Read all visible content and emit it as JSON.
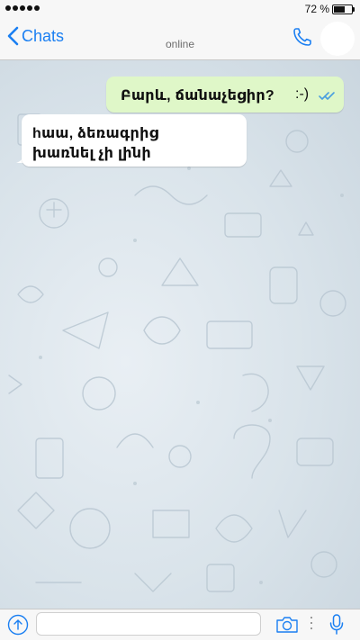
{
  "status_bar": {
    "battery_percent_label": "72 %",
    "battery_level": 0.72
  },
  "nav": {
    "back_label": "Chats",
    "subtitle": "online"
  },
  "messages": [
    {
      "direction": "outgoing",
      "text": "Բարև, ճանաչեցիր?",
      "emoticon": ":-)",
      "status": "read-double-check"
    },
    {
      "direction": "incoming",
      "lines": [
        "hաա, ձեռագրից",
        "խառնել չի լինի"
      ]
    }
  ],
  "input": {
    "value": "",
    "placeholder": ""
  },
  "icons": {
    "back": "chevron-left-icon",
    "call": "phone-icon",
    "upload": "upload-arrow-icon",
    "camera": "camera-icon",
    "mic": "microphone-icon",
    "read_status": "double-check-icon"
  },
  "colors": {
    "accent": "#1a7ff2",
    "outgoing_bubble": "#dff7c8",
    "incoming_bubble": "#ffffff",
    "chat_background": "#d9e3ea",
    "read_ticks": "#4a9fe0"
  }
}
